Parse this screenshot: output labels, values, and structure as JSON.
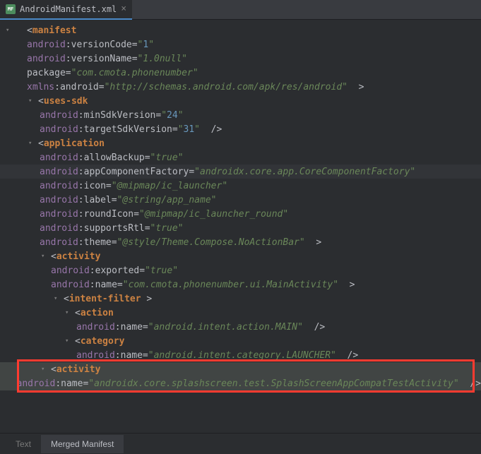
{
  "tab": {
    "label": "AndroidManifest.xml"
  },
  "lines": {
    "manifest": "manifest",
    "android": "android",
    "xmlns": "xmlns",
    "package": "package",
    "versionCode": ":versionCode=",
    "versionCodeVal": "1",
    "versionName": ":versionName=",
    "versionNameVal": "1.0null",
    "packageAttr": "=",
    "packageVal": "com.cmota.phonenumber",
    "xmlnsAttr": ":android=",
    "xmlnsVal": "http://schemas.android.com/apk/res/android",
    "usesSdk": "uses-sdk",
    "minSdk": ":minSdkVersion=",
    "minSdkVal": "24",
    "targetSdk": ":targetSdkVersion=",
    "targetSdkVal": "31",
    "application": "application",
    "allowBackup": ":allowBackup=",
    "trueVal": "true",
    "appComponentFactory": ":appComponentFactory=",
    "appComponentFactoryVal": "androidx.core.app.CoreComponentFactory",
    "icon": ":icon=",
    "iconVal": "@mipmap/ic_launcher",
    "label": ":label=",
    "labelVal": "@string/app_name",
    "roundIcon": ":roundIcon=",
    "roundIconVal": "@mipmap/ic_launcher_round",
    "supportsRtl": ":supportsRtl=",
    "theme": ":theme=",
    "themeVal": "@style/Theme.Compose.NoActionBar",
    "activity": "activity",
    "exported": ":exported=",
    "name": ":name=",
    "mainActivityVal": "com.cmota.phonenumber.ui.MainActivity",
    "intentFilter": "intent-filter",
    "action": "action",
    "actionVal": "android.intent.action.MAIN",
    "category": "category",
    "categoryVal": "android.intent.category.LAUNCHER",
    "splashVal": "androidx.core.splashscreen.test.SplashScreenAppCompatTestActivity"
  },
  "bottomTabs": {
    "text": "Text",
    "merged": "Merged Manifest"
  }
}
